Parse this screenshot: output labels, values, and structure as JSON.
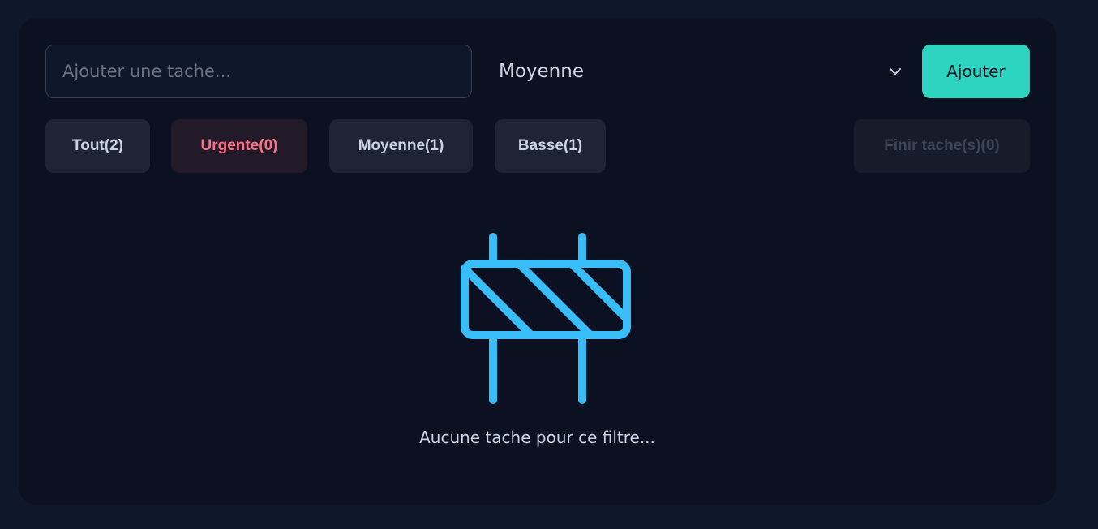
{
  "task_input": {
    "placeholder": "Ajouter une tache...",
    "value": ""
  },
  "priority_select": {
    "selected": "Moyenne",
    "icon": "chevron-down-icon"
  },
  "add_button": {
    "label": "Ajouter"
  },
  "filters": {
    "all": "Tout(2)",
    "urgent": "Urgente(0)",
    "medium": "Moyenne(1)",
    "low": "Basse(1)"
  },
  "finish_button": {
    "label": "Finir tache(s)(0)"
  },
  "empty_state": {
    "icon": "road-barrier-icon",
    "message": "Aucune tache pour ce filtre..."
  },
  "colors": {
    "accent": "#2dd4bf",
    "urgent": "#fb7185",
    "icon": "#38bdf8",
    "background": "#0f172a",
    "panel": "#0b1120"
  }
}
